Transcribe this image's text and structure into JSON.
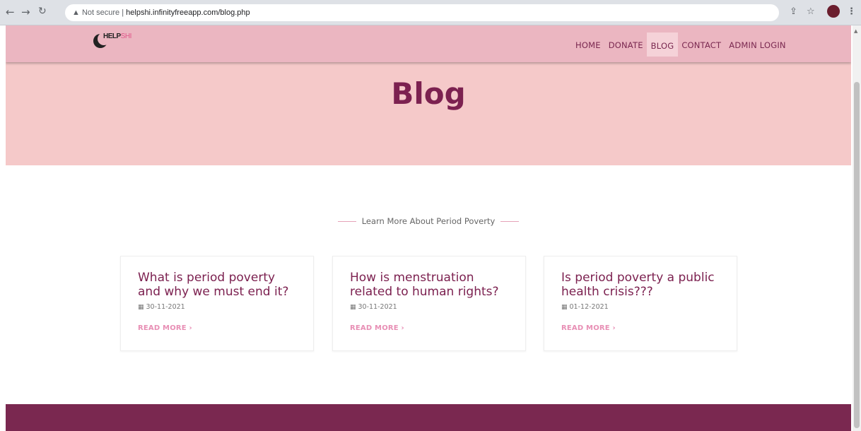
{
  "browser": {
    "security_label": "Not secure",
    "separator": "|",
    "url": "helpshi.infinityfreeapp.com/blog.php"
  },
  "logo": {
    "main": "HELP",
    "accent": "SHI"
  },
  "nav": {
    "items": [
      {
        "label": "HOME"
      },
      {
        "label": "DONATE"
      },
      {
        "label": "BLOG",
        "active": true
      },
      {
        "label": "CONTACT"
      },
      {
        "label": "ADMIN LOGIN"
      }
    ]
  },
  "hero": {
    "title": "Blog"
  },
  "section": {
    "title": "Learn More About Period Poverty"
  },
  "posts": [
    {
      "title": "What is period poverty and why we must end it?",
      "date": "30-11-2021",
      "read_more": "READ MORE"
    },
    {
      "title": "How is menstruation related to human rights?",
      "date": "30-11-2021",
      "read_more": "READ MORE"
    },
    {
      "title": "Is period poverty a public health crisis???",
      "date": "01-12-2021",
      "read_more": "READ MORE"
    }
  ],
  "colors": {
    "navbar": "#ebb6c1",
    "hero": "#f5c9c9",
    "accent": "#7c2150",
    "footer": "#7a2850"
  }
}
